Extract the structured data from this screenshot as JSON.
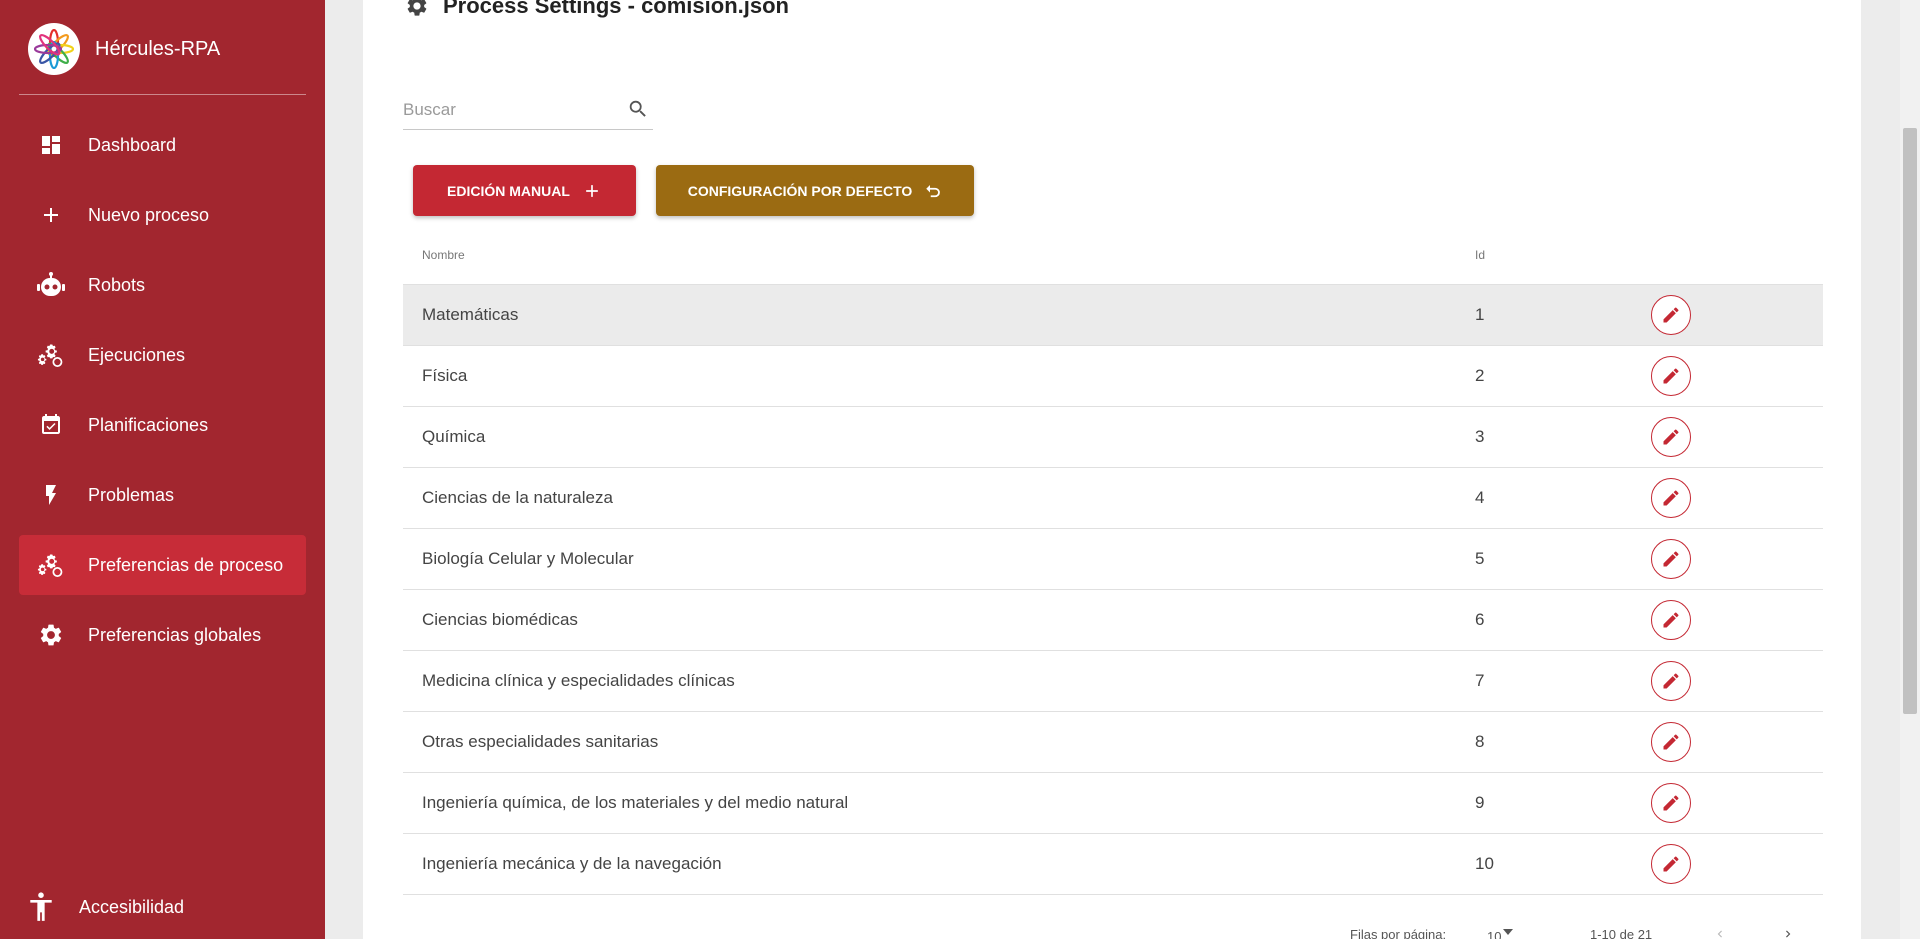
{
  "brand": {
    "name": "Hércules-RPA"
  },
  "sidebar": {
    "items": [
      {
        "label": "Dashboard",
        "icon": "dashboard-icon"
      },
      {
        "label": "Nuevo proceso",
        "icon": "plus-icon"
      },
      {
        "label": "Robots",
        "icon": "robot-icon"
      },
      {
        "label": "Ejecuciones",
        "icon": "cogs-icon"
      },
      {
        "label": "Planificaciones",
        "icon": "calendar-check-icon"
      },
      {
        "label": "Problemas",
        "icon": "lightning-icon"
      },
      {
        "label": "Preferencias de proceso",
        "icon": "cogs-icon",
        "active": true
      },
      {
        "label": "Preferencias globales",
        "icon": "gear-icon"
      }
    ],
    "accessibility": "Accesibilidad"
  },
  "page": {
    "title": "Process Settings - comision.json"
  },
  "search": {
    "placeholder": "Buscar"
  },
  "buttons": {
    "manual": "EDICIÓN MANUAL",
    "default": "CONFIGURACIÓN POR DEFECTO"
  },
  "table": {
    "headers": {
      "name": "Nombre",
      "id": "Id"
    },
    "rows": [
      {
        "name": "Matemáticas",
        "id": "1"
      },
      {
        "name": "Física",
        "id": "2"
      },
      {
        "name": "Química",
        "id": "3"
      },
      {
        "name": "Ciencias de la naturaleza",
        "id": "4"
      },
      {
        "name": "Biología Celular y Molecular",
        "id": "5"
      },
      {
        "name": "Ciencias biomédicas",
        "id": "6"
      },
      {
        "name": "Medicina clínica y especialidades clínicas",
        "id": "7"
      },
      {
        "name": "Otras especialidades sanitarias",
        "id": "8"
      },
      {
        "name": "Ingeniería química, de los materiales y del medio natural",
        "id": "9"
      },
      {
        "name": "Ingeniería mecánica y de la navegación",
        "id": "10"
      }
    ]
  },
  "pagination": {
    "rows_per_page_label": "Filas por página:",
    "rows_per_page": "10",
    "range": "1-10 de 21"
  },
  "colors": {
    "sidebar": "#a2262f",
    "sidebar_active": "#c72c38",
    "primary": "#c42833",
    "secondary": "#9b6b12"
  }
}
